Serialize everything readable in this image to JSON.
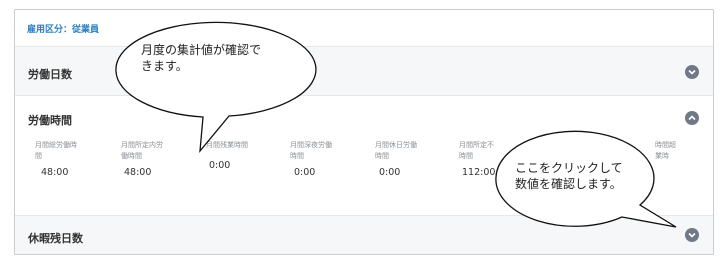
{
  "employment_label": "雇用区分：従業員",
  "sections": {
    "days": {
      "title": "労働日数",
      "state": "collapsed"
    },
    "hours": {
      "title": "労働時間",
      "state": "expanded"
    },
    "leave": {
      "title": "休暇残日数",
      "state": "collapsed"
    }
  },
  "metrics": [
    {
      "label_line1": "月間総労働時",
      "label_line2": "間",
      "value": "48:00"
    },
    {
      "label_line1": "月間所定内労",
      "label_line2": "働時間",
      "value": "48:00"
    },
    {
      "label_line1": "月間残業時間",
      "label_line2": "",
      "value": "0:00"
    },
    {
      "label_line1": "月間深夜労働",
      "label_line2": "時間",
      "value": "0:00"
    },
    {
      "label_line1": "月間休日労働",
      "label_line2": "時間",
      "value": "0:00"
    },
    {
      "label_line1": "月間所定不",
      "label_line2": "時間",
      "value": "112:00"
    },
    {
      "label_line1": "時間超",
      "label_line2": "業時",
      "value": ""
    }
  ],
  "callouts": {
    "top": "月度の集計値が確認で\nきます。",
    "right": "ここをクリックして\n数値を確認します。"
  },
  "icons": {
    "expand": "chevron-down-icon",
    "collapse": "chevron-up-icon"
  },
  "colors": {
    "accent": "#2a7fbf",
    "button": "#6f7a86"
  }
}
